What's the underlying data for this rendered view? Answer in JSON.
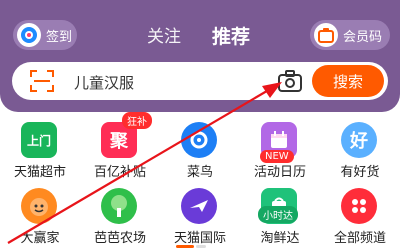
{
  "header": {
    "signin_label": "签到",
    "follow_tab": "关注",
    "recommend_tab": "推荐",
    "member_label": "会员码",
    "bg_color": "#7a5a93"
  },
  "search": {
    "query": "儿童汉服",
    "button_label": "搜索",
    "button_color": "#ff5a00"
  },
  "grid": [
    {
      "label": "天猫超市",
      "icon": "tmall-supermarket-icon",
      "icon_text": "上门",
      "color": "#19b55a"
    },
    {
      "label": "百亿补贴",
      "icon": "subsidy-icon",
      "icon_text": "聚",
      "badge": "狂补",
      "color": "#ff2d55"
    },
    {
      "label": "菜鸟",
      "icon": "cainiao-icon",
      "color": "#1d7ff5"
    },
    {
      "label": "活动日历",
      "icon": "calendar-icon",
      "badge": "NEW",
      "color": "#b268e6"
    },
    {
      "label": "有好货",
      "icon": "good-goods-icon",
      "icon_text": "好",
      "color": "#5ab0ff"
    },
    {
      "label": "大赢家",
      "icon": "winner-icon",
      "color": "#ff8a20"
    },
    {
      "label": "芭芭农场",
      "icon": "baba-farm-icon",
      "color": "#2fbf4a"
    },
    {
      "label": "天猫国际",
      "icon": "tmall-global-icon",
      "color": "#6a3bd8"
    },
    {
      "label": "淘鲜达",
      "icon": "taoxianda-icon",
      "badge": "小时达",
      "color": "#1fc27a"
    },
    {
      "label": "全部频道",
      "icon": "all-channels-icon",
      "color": "#ff2d3a"
    }
  ]
}
